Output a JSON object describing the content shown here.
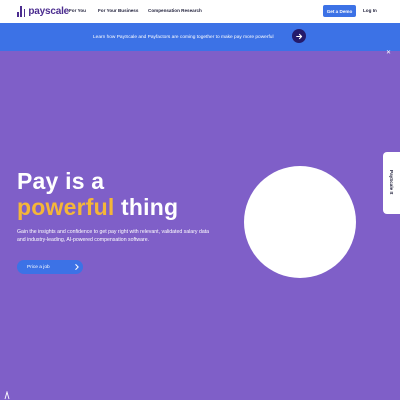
{
  "brand": {
    "logo_text": "payscale",
    "logo_icon": "bar-chart-icon"
  },
  "nav": {
    "items": [
      {
        "label": "For You"
      },
      {
        "label": "For Your Business"
      },
      {
        "label": "Compensation Research"
      }
    ],
    "demo_label": "Get a Demo",
    "login_label": "Log In"
  },
  "banner": {
    "text": "Learn how PayScale and Payfactors are coming together to make pay more powerful",
    "arrow_icon": "arrow-right-icon",
    "close_icon": "close-icon"
  },
  "hero": {
    "line1": "Pay is a",
    "accent": "powerful",
    "rest": " thing",
    "description": "Gain the insights and confidence to get pay right with relevant, validated salary data and industry-leading, AI-powered compensation software.",
    "cta_label": "Price a job",
    "cta_icon": "chevron-right-icon"
  },
  "side_tab": {
    "label": "PayScale It"
  },
  "colors": {
    "background": "#7f5fc8",
    "primary_blue": "#3c72e6",
    "accent_yellow": "#f5b638",
    "brand_purple": "#4b2c8f",
    "arrow_circle": "#241a6b"
  }
}
